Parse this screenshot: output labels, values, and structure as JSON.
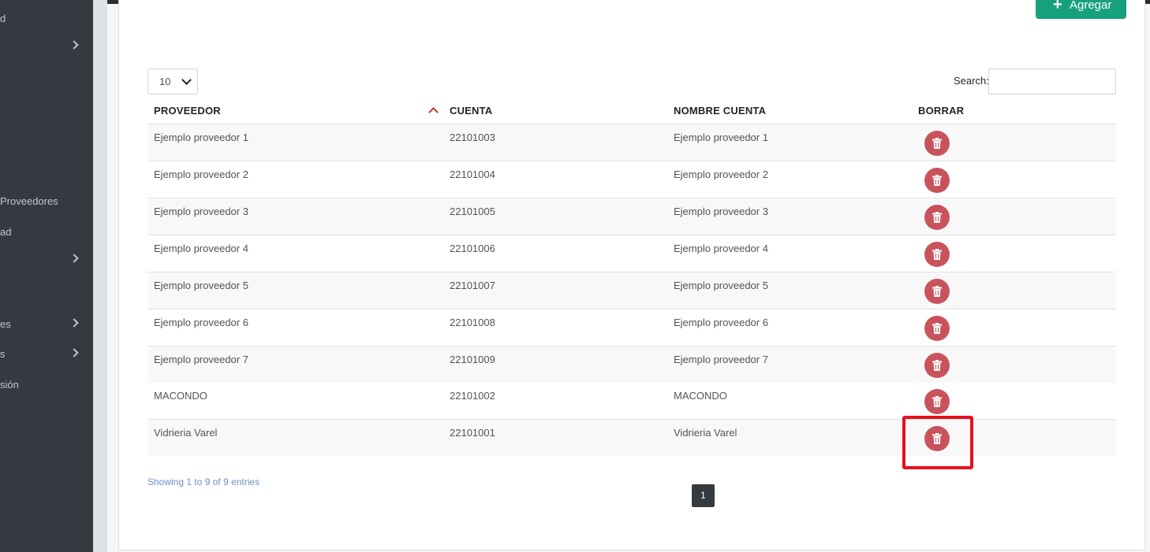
{
  "sidebar": {
    "items": [
      {
        "label": "d",
        "chevron": false
      },
      {
        "label": "",
        "chevron": true
      },
      {
        "label": "Proveedores",
        "chevron": false
      },
      {
        "label": "ad",
        "chevron": false
      },
      {
        "label": "",
        "chevron": true
      },
      {
        "label": "es",
        "chevron": true
      },
      {
        "label": "s",
        "chevron": true
      },
      {
        "label": "sión",
        "chevron": false
      }
    ]
  },
  "toolbar": {
    "add_label": "Agregar"
  },
  "table_controls": {
    "page_length": "10",
    "search_label": "Search:",
    "search_value": ""
  },
  "table": {
    "headers": [
      "PROVEEDOR",
      "CUENTA",
      "NOMBRE CUENTA",
      "BORRAR"
    ],
    "rows": [
      {
        "proveedor": "Ejemplo proveedor 1",
        "cuenta": "22101003",
        "nombre_cuenta": "Ejemplo proveedor 1"
      },
      {
        "proveedor": "Ejemplo proveedor 2",
        "cuenta": "22101004",
        "nombre_cuenta": "Ejemplo proveedor 2"
      },
      {
        "proveedor": "Ejemplo proveedor 3",
        "cuenta": "22101005",
        "nombre_cuenta": "Ejemplo proveedor 3"
      },
      {
        "proveedor": "Ejemplo proveedor 4",
        "cuenta": "22101006",
        "nombre_cuenta": "Ejemplo proveedor 4"
      },
      {
        "proveedor": "Ejemplo proveedor 5",
        "cuenta": "22101007",
        "nombre_cuenta": "Ejemplo proveedor 5"
      },
      {
        "proveedor": "Ejemplo proveedor 6",
        "cuenta": "22101008",
        "nombre_cuenta": "Ejemplo proveedor 6"
      },
      {
        "proveedor": "Ejemplo proveedor 7",
        "cuenta": "22101009",
        "nombre_cuenta": "Ejemplo proveedor 7"
      },
      {
        "proveedor": "MACONDO",
        "cuenta": "22101002",
        "nombre_cuenta": "MACONDO"
      },
      {
        "proveedor": "Vidrieria Varel",
        "cuenta": "22101001",
        "nombre_cuenta": "Vidrieria Varel"
      }
    ]
  },
  "footer": {
    "info": "Showing 1 to 9 of 9 entries",
    "current_page": "1"
  },
  "colors": {
    "accent": "#17a07e",
    "delete": "#c9535c",
    "highlight": "#e8101a",
    "sidebar": "#343a40"
  },
  "icons": {
    "add": "plus-icon",
    "delete": "trash-icon",
    "sort": "sort-asc-icon",
    "chevron": "chevron-right-icon"
  }
}
